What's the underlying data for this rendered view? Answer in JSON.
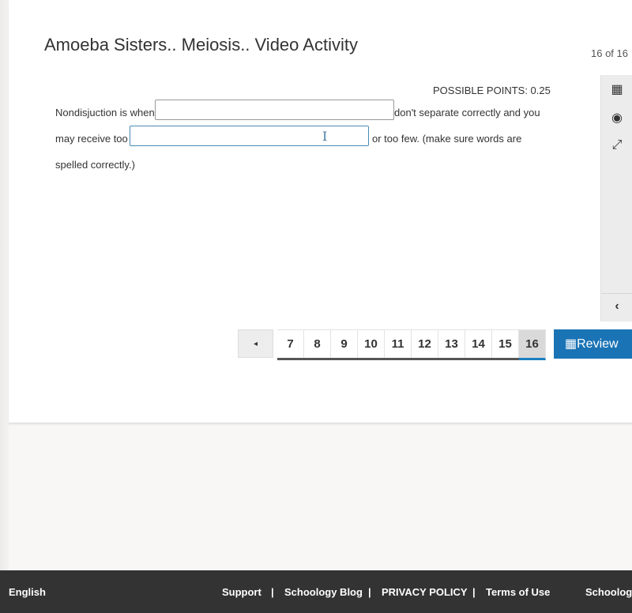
{
  "header": {
    "title": "Amoeba Sisters.. Meiosis.. Video Activity",
    "counter": "16 of 16"
  },
  "question": {
    "points": "POSSIBLE POINTS: 0.25",
    "part1": "Nondisjuction is when",
    "part2": "don't separate correctly and you",
    "part3": "may receive too",
    "part4": "or too few. (make sure words are",
    "part5": "spelled correctly.)",
    "input1_value": "",
    "input2_value": ""
  },
  "rail": {
    "icons": [
      "calendar-icon",
      "accessibility-icon",
      "expand-icon"
    ],
    "collapse": "‹"
  },
  "pager": {
    "prev": "◂",
    "pages": [
      "7",
      "8",
      "9",
      "10",
      "11",
      "12",
      "13",
      "14",
      "15",
      "16"
    ],
    "active": "16",
    "review_label": "Review"
  },
  "footer": {
    "language": "English",
    "links": [
      "Support",
      "|",
      "Schoology Blog",
      "|",
      "PRIVACY POLICY",
      "|",
      "Terms of Use"
    ],
    "brand": "Schoology"
  }
}
